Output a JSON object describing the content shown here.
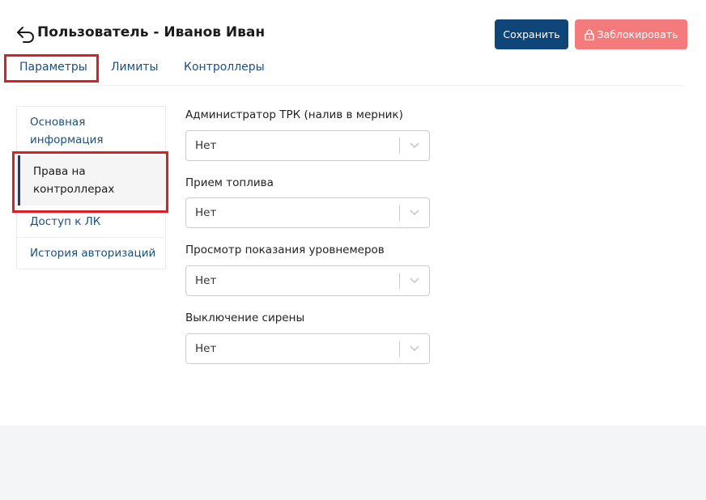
{
  "header": {
    "title": "Пользователь - Иванов Иван",
    "save_label": "Сохранить",
    "block_label": "Заблокировать"
  },
  "tabs": [
    {
      "label": "Параметры",
      "active": true
    },
    {
      "label": "Лимиты"
    },
    {
      "label": "Контроллеры"
    }
  ],
  "sidebar": {
    "items": [
      {
        "label_line1": "Основная",
        "label_line2": "информация"
      },
      {
        "label_line1": "Права на",
        "label_line2": "контроллерах",
        "active": true
      },
      {
        "label": "Доступ к ЛК"
      },
      {
        "label": "История авторизаций"
      }
    ]
  },
  "fields": [
    {
      "label": "Администратор ТРК (налив в мерник)",
      "value": "Нет"
    },
    {
      "label": "Прием топлива",
      "value": "Нет"
    },
    {
      "label": "Просмотр показания уровнемеров",
      "value": "Нет"
    },
    {
      "label": "Выключение сирены",
      "value": "Нет"
    }
  ],
  "colors": {
    "primary": "#0f4679",
    "danger": "#f37b7b",
    "link": "#1d4f7c",
    "highlight": "#e11d24"
  },
  "icons": [
    "back-arrow-icon",
    "lock-icon",
    "chevron-down-icon"
  ]
}
